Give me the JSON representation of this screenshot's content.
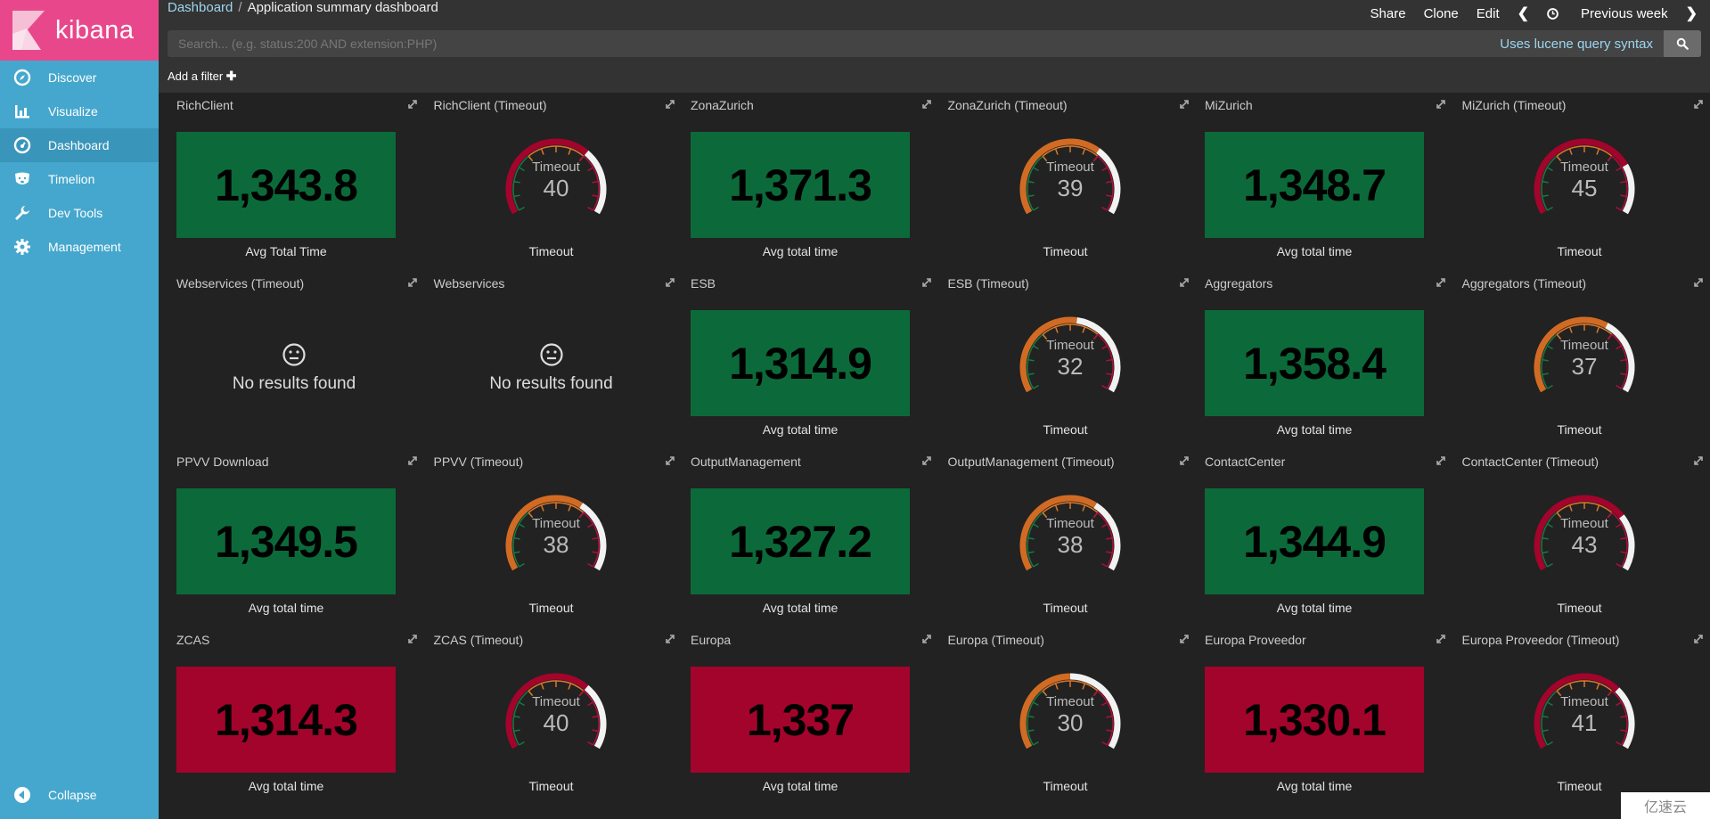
{
  "app": {
    "logo_text": "kibana"
  },
  "sidebar": {
    "items": [
      {
        "label": "Discover",
        "icon": "compass-icon",
        "active": false
      },
      {
        "label": "Visualize",
        "icon": "bar-chart-icon",
        "active": false
      },
      {
        "label": "Dashboard",
        "icon": "dashboard-gauge-icon",
        "active": true
      },
      {
        "label": "Timelion",
        "icon": "timelion-bear-icon",
        "active": false
      },
      {
        "label": "Dev Tools",
        "icon": "wrench-icon",
        "active": false
      },
      {
        "label": "Management",
        "icon": "gear-icon",
        "active": false
      }
    ],
    "collapse_label": "Collapse"
  },
  "header": {
    "breadcrumb_root": "Dashboard",
    "breadcrumb_separator": "/",
    "breadcrumb_current": "Application summary dashboard",
    "actions": {
      "share": "Share",
      "clone": "Clone",
      "edit": "Edit",
      "time_range": "Previous week"
    }
  },
  "search": {
    "placeholder": "Search... (e.g. status:200 AND extension:PHP)",
    "value": "",
    "syntax_label": "Uses lucene query syntax"
  },
  "filter": {
    "add_label": "Add a filter"
  },
  "colors": {
    "green": "#0c6a3a",
    "red": "#a3042c",
    "orange": "#d16b24",
    "gauge_empty": "#f2f2f2",
    "tick_green": "#137a42",
    "tick_orange": "#d9782a",
    "tick_red": "#b40c3a"
  },
  "gauge_scale": {
    "min": 0,
    "max": 60,
    "ranges": [
      [
        0,
        20,
        "green"
      ],
      [
        20,
        40,
        "orange"
      ],
      [
        40,
        60,
        "red"
      ]
    ]
  },
  "panels": [
    {
      "title": "RichClient",
      "type": "metric",
      "value": "1,343.8",
      "status": "green",
      "label": "Avg Total Time"
    },
    {
      "title": "RichClient (Timeout)",
      "type": "gauge",
      "value": 40,
      "gauge_title": "Timeout",
      "label": "Timeout"
    },
    {
      "title": "ZonaZurich",
      "type": "metric",
      "value": "1,371.3",
      "status": "green",
      "label": "Avg total time"
    },
    {
      "title": "ZonaZurich (Timeout)",
      "type": "gauge",
      "value": 39,
      "gauge_title": "Timeout",
      "label": "Timeout"
    },
    {
      "title": "MiZurich",
      "type": "metric",
      "value": "1,348.7",
      "status": "green",
      "label": "Avg total time"
    },
    {
      "title": "MiZurich (Timeout)",
      "type": "gauge",
      "value": 45,
      "gauge_title": "Timeout",
      "label": "Timeout"
    },
    {
      "title": "Webservices (Timeout)",
      "type": "empty",
      "message": "No results found"
    },
    {
      "title": "Webservices",
      "type": "empty",
      "message": "No results found"
    },
    {
      "title": "ESB",
      "type": "metric",
      "value": "1,314.9",
      "status": "green",
      "label": "Avg total time"
    },
    {
      "title": "ESB (Timeout)",
      "type": "gauge",
      "value": 32,
      "gauge_title": "Timeout",
      "label": "Timeout"
    },
    {
      "title": "Aggregators",
      "type": "metric",
      "value": "1,358.4",
      "status": "green",
      "label": "Avg total time"
    },
    {
      "title": "Aggregators (Timeout)",
      "type": "gauge",
      "value": 37,
      "gauge_title": "Timeout",
      "label": "Timeout"
    },
    {
      "title": "PPVV Download",
      "type": "metric",
      "value": "1,349.5",
      "status": "green",
      "label": "Avg total time"
    },
    {
      "title": "PPVV (Timeout)",
      "type": "gauge",
      "value": 38,
      "gauge_title": "Timeout",
      "label": "Timeout"
    },
    {
      "title": "OutputManagement",
      "type": "metric",
      "value": "1,327.2",
      "status": "green",
      "label": "Avg total time"
    },
    {
      "title": "OutputManagement (Timeout)",
      "type": "gauge",
      "value": 38,
      "gauge_title": "Timeout",
      "label": "Timeout"
    },
    {
      "title": "ContactCenter",
      "type": "metric",
      "value": "1,344.9",
      "status": "green",
      "label": "Avg total time"
    },
    {
      "title": "ContactCenter (Timeout)",
      "type": "gauge",
      "value": 43,
      "gauge_title": "Timeout",
      "label": "Timeout"
    },
    {
      "title": "ZCAS",
      "type": "metric",
      "value": "1,314.3",
      "status": "red",
      "label": "Avg total time"
    },
    {
      "title": "ZCAS (Timeout)",
      "type": "gauge",
      "value": 40,
      "gauge_title": "Timeout",
      "label": "Timeout"
    },
    {
      "title": "Europa",
      "type": "metric",
      "value": "1,337",
      "status": "red",
      "label": "Avg total time"
    },
    {
      "title": "Europa (Timeout)",
      "type": "gauge",
      "value": 30,
      "gauge_title": "Timeout",
      "label": "Timeout"
    },
    {
      "title": "Europa Proveedor",
      "type": "metric",
      "value": "1,330.1",
      "status": "red",
      "label": "Avg total time"
    },
    {
      "title": "Europa Proveedor (Timeout)",
      "type": "gauge",
      "value": 41,
      "gauge_title": "Timeout",
      "label": "Timeout"
    }
  ],
  "watermark": "亿速云"
}
